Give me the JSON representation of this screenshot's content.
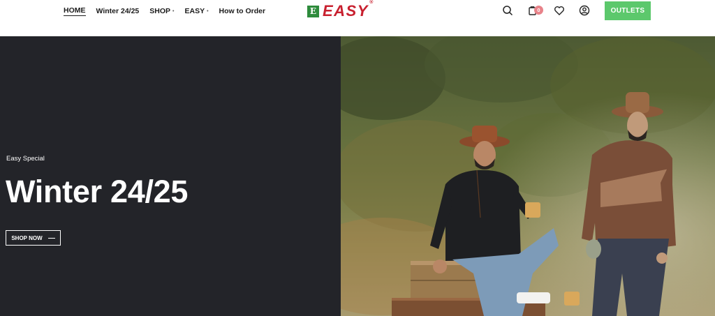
{
  "nav": {
    "items": [
      {
        "label": "HOME",
        "has_dropdown": false,
        "active": true
      },
      {
        "label": "Winter 24/25",
        "has_dropdown": false,
        "active": false
      },
      {
        "label": "SHOP",
        "has_dropdown": true,
        "active": false
      },
      {
        "label": "EASY",
        "has_dropdown": true,
        "active": false
      },
      {
        "label": "How to Order",
        "has_dropdown": false,
        "active": false
      }
    ],
    "caret": "•"
  },
  "brand": {
    "logo_mark": "E",
    "name": "EASY",
    "registered": "®",
    "brand_color": "#c8202f",
    "mark_color": "#2e8b3c"
  },
  "header_icons": [
    {
      "name": "search-icon"
    },
    {
      "name": "cart-icon",
      "badge": "0"
    },
    {
      "name": "heart-icon"
    },
    {
      "name": "account-icon"
    }
  ],
  "outlets_label": "OUTLETS",
  "outlets_color": "#5cc86c",
  "hero": {
    "eyebrow": "Easy Special",
    "title": "Winter 24/25",
    "cta_label": "SHOP NOW",
    "panel_color": "#232429"
  }
}
